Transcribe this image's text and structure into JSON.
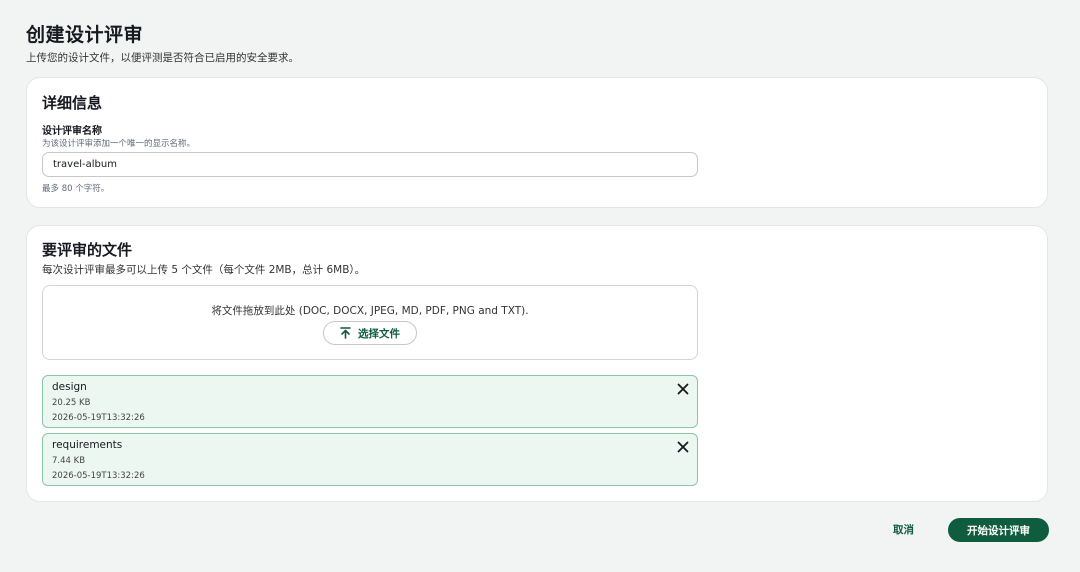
{
  "page": {
    "title": "创建设计评审",
    "description": "上传您的设计文件，以便评测是否符合已启用的安全要求。"
  },
  "details": {
    "heading": "详细信息",
    "name_label": "设计评审名称",
    "name_description": "为该设计评审添加一个唯一的显示名称。",
    "name_value": "travel-album",
    "name_constraint": "最多 80 个字符。"
  },
  "files": {
    "heading": "要评审的文件",
    "description": "每次设计评审最多可以上传 5 个文件（每个文件 2MB，总计 6MB）。",
    "dropzone_text": "将文件拖放到此处 (DOC, DOCX, JPEG, MD, PDF, PNG and TXT).",
    "choose_label": "选择文件",
    "items": [
      {
        "name": "design",
        "size": "20.25 KB",
        "modified": "2026-05-19T13:32:26"
      },
      {
        "name": "requirements",
        "size": "7.44 KB",
        "modified": "2026-05-19T13:32:26"
      }
    ]
  },
  "actions": {
    "cancel_label": "取消",
    "submit_label": "开始设计评审"
  },
  "icons": {
    "upload": "upload-arrow-icon",
    "remove": "close-icon"
  },
  "colors": {
    "brand": "#0f5c3f",
    "token_bg": "#edf7f1",
    "token_border": "#8cc4a8",
    "page_bg": "#f2f3f3"
  }
}
